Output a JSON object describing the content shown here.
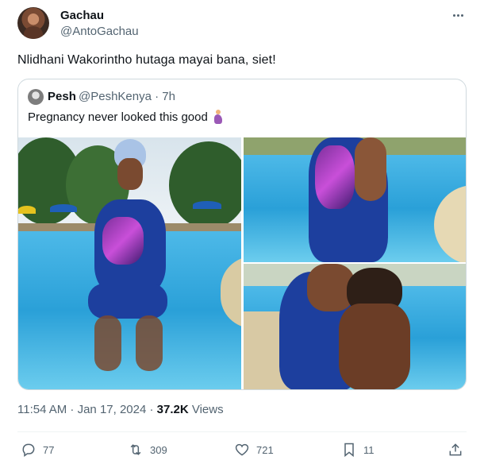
{
  "author": {
    "display_name": "Gachau",
    "handle": "@AntoGachau"
  },
  "tweet_text": "Nlidhani Wakorintho hutaga mayai bana, siet!",
  "quoted": {
    "display_name": "Pesh",
    "handle": "@PeshKenya",
    "time": "· 7h",
    "text": "Pregnancy never looked this good",
    "emoji_icon": "pregnant-woman-icon"
  },
  "meta": {
    "timestamp": "11:54 AM · Jan 17, 2024 · ",
    "views_count": "37.2K",
    "views_label": " Views"
  },
  "actions": {
    "replies": "77",
    "retweets": "309",
    "likes": "721",
    "bookmarks": "11"
  },
  "colors": {
    "secondary_text": "#536471",
    "border": "#cfd9de",
    "pool_blue": "#2aa0d8",
    "swimsuit": "#1d3f9e",
    "swimsuit_print": "#c94fd9"
  }
}
